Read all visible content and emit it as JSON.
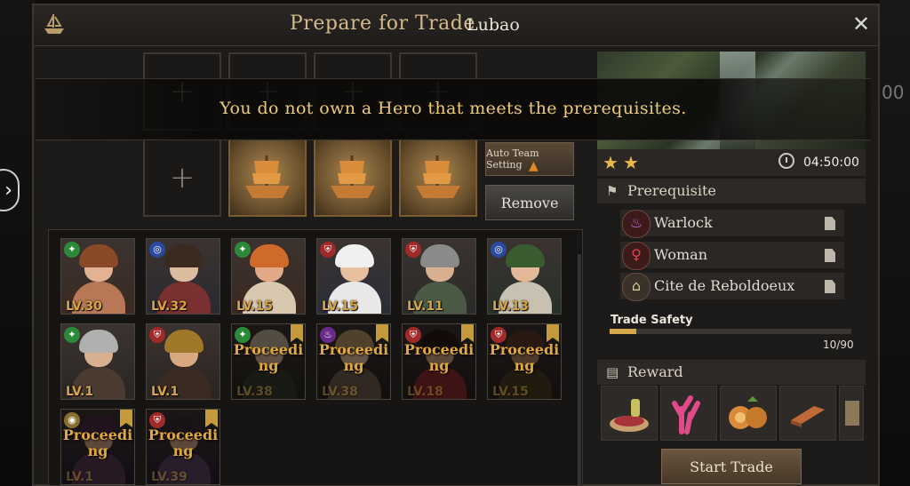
{
  "window": {
    "title": "Prepare for Trade",
    "subtitle": "Lubao",
    "close_label": "✕"
  },
  "side": {
    "nav_arrow": "›",
    "background_text": "00"
  },
  "banner": {
    "message": "You do not own a Hero that meets the prerequisites."
  },
  "slots": {
    "add_glyph": "+",
    "empty_count": 5,
    "ship_count": 3
  },
  "buttons": {
    "auto_team": "Auto Team Setting",
    "remove": "Remove",
    "start_trade": "Start Trade"
  },
  "heroes": [
    {
      "level": "LV.30",
      "class_icon": "green-diamond-icon",
      "state": "available"
    },
    {
      "level": "LV.32",
      "class_icon": "blue-swirl-icon",
      "state": "available"
    },
    {
      "level": "LV.15",
      "class_icon": "green-diamond-icon",
      "state": "available"
    },
    {
      "level": "LV.15",
      "class_icon": "red-shield-icon",
      "state": "available"
    },
    {
      "level": "LV.11",
      "class_icon": "red-shield-icon",
      "state": "available"
    },
    {
      "level": "LV.13",
      "class_icon": "blue-swirl-icon",
      "state": "available"
    },
    {
      "level": "LV.1",
      "class_icon": "green-diamond-icon",
      "state": "available"
    },
    {
      "level": "LV.1",
      "class_icon": "red-shield-icon",
      "state": "available"
    },
    {
      "level": "LV.38",
      "class_icon": "green-diamond-icon",
      "state": "proceeding",
      "status": "Proceeding"
    },
    {
      "level": "LV.38",
      "class_icon": "purple-flame-icon",
      "state": "proceeding",
      "status": "Proceeding"
    },
    {
      "level": "LV.18",
      "class_icon": "red-shield-icon",
      "state": "proceeding",
      "status": "Proceeding"
    },
    {
      "level": "LV.15",
      "class_icon": "red-shield-icon",
      "state": "proceeding",
      "status": "Proceeding"
    },
    {
      "level": "LV.1",
      "class_icon": "gold-eye-icon",
      "state": "proceeding",
      "status": "Proceeding"
    },
    {
      "level": "LV.39",
      "class_icon": "red-shield-icon",
      "state": "proceeding",
      "status": "Proceeding"
    }
  ],
  "trade": {
    "stars": 2,
    "star_glyph": "★",
    "timer": "04:50:00",
    "prerequisite_title": "Prerequisite",
    "prerequisites": [
      {
        "label": "Warlock",
        "icon": "purple-flame-icon"
      },
      {
        "label": "Woman",
        "icon": "female-symbol-icon"
      },
      {
        "label": "Cite de Reboldoeux",
        "icon": "city-building-icon"
      }
    ],
    "safety_label": "Trade Safety",
    "safety_value": "10/90",
    "safety_fraction": 0.111,
    "reward_title": "Reward",
    "rewards": [
      "meat-basket-icon",
      "coral-icon",
      "fruit-icon",
      "ingot-icon",
      "map-icon"
    ]
  },
  "colors": {
    "accent_gold": "#d4b98a",
    "banner_text": "#efcb79",
    "level_text": "#d9a640",
    "proceeding_text": "#e3a83a"
  }
}
